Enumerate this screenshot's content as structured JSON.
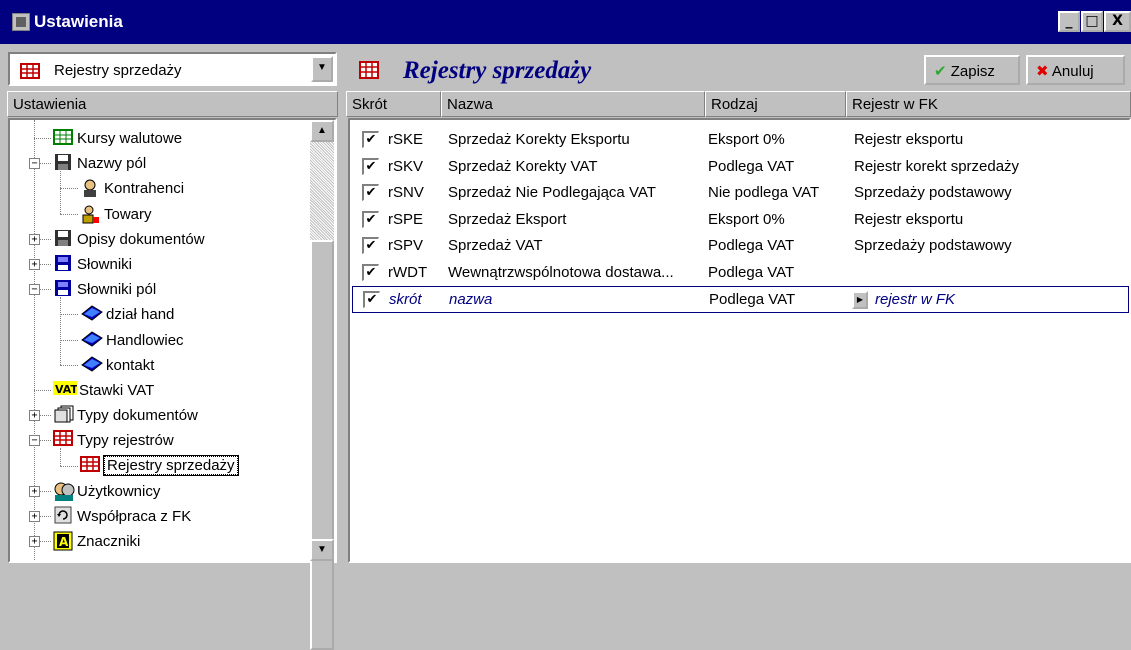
{
  "window": {
    "title": "Ustawienia",
    "min": "_",
    "max": "□",
    "close": "X"
  },
  "left": {
    "combo_value": "Rejestry sprzedaży",
    "header": "Ustawienia",
    "tree": [
      {
        "label": "Kursy walutowe",
        "icon": "table-icon",
        "level": 1
      },
      {
        "label": "Nazwy pól",
        "icon": "disk-icon",
        "level": 0,
        "exp": "−"
      },
      {
        "label": "Kontrahenci",
        "icon": "person-icon",
        "level": 2
      },
      {
        "label": "Towary",
        "icon": "product-icon",
        "level": 2
      },
      {
        "label": "Opisy dokumentów",
        "icon": "disk-icon",
        "level": 0,
        "exp": "+"
      },
      {
        "label": "Słowniki",
        "icon": "book-icon",
        "level": 0,
        "exp": "+"
      },
      {
        "label": "Słowniki pól",
        "icon": "book-icon",
        "level": 0,
        "exp": "−"
      },
      {
        "label": "dział hand",
        "icon": "dictionary-icon",
        "level": 2
      },
      {
        "label": "Handlowiec",
        "icon": "dictionary-icon",
        "level": 2
      },
      {
        "label": "kontakt",
        "icon": "dictionary-icon",
        "level": 2
      },
      {
        "label": "Stawki VAT",
        "icon": "vat-icon",
        "level": 1
      },
      {
        "label": "Typy dokumentów",
        "icon": "documents-icon",
        "level": 0,
        "exp": "+"
      },
      {
        "label": "Typy rejestrów",
        "icon": "register-icon",
        "level": 0,
        "exp": "−"
      },
      {
        "label": "Rejestry sprzedaży",
        "icon": "register-icon",
        "level": 2,
        "selected": true
      },
      {
        "label": "Użytkownicy",
        "icon": "users-icon",
        "level": 0,
        "exp": "+"
      },
      {
        "label": "Współpraca z FK",
        "icon": "sync-icon",
        "level": 0,
        "exp": "+"
      },
      {
        "label": "Znaczniki",
        "icon": "marker-icon",
        "level": 0,
        "exp": "+"
      }
    ],
    "vat_text": "VAT",
    "marker_text": "A"
  },
  "right": {
    "title": "Rejestry sprzedaży",
    "save_label": "Zapisz",
    "cancel_label": "Anuluj",
    "columns": [
      "Skrót",
      "Nazwa",
      "Rodzaj",
      "Rejestr w FK"
    ],
    "rows": [
      {
        "checked": true,
        "skrot": "rSKE",
        "nazwa": "Sprzedaż Korekty Eksportu",
        "rodzaj": "Eksport 0%",
        "rejestr": "Rejestr eksportu"
      },
      {
        "checked": true,
        "skrot": "rSKV",
        "nazwa": "Sprzedaż Korekty VAT",
        "rodzaj": "Podlega VAT",
        "rejestr": "Rejestr korekt sprzedaży"
      },
      {
        "checked": true,
        "skrot": "rSNV",
        "nazwa": "Sprzedaż Nie Podlegająca VAT",
        "rodzaj": "Nie podlega VAT",
        "rejestr": "Sprzedaży podstawowy"
      },
      {
        "checked": true,
        "skrot": "rSPE",
        "nazwa": "Sprzedaż Eksport",
        "rodzaj": "Eksport 0%",
        "rejestr": "Rejestr eksportu"
      },
      {
        "checked": true,
        "skrot": "rSPV",
        "nazwa": "Sprzedaż VAT",
        "rodzaj": "Podlega VAT",
        "rejestr": "Sprzedaży podstawowy"
      },
      {
        "checked": true,
        "skrot": "rWDT",
        "nazwa": "Wewnątrzwspólnotowa dostawa...",
        "rodzaj": "Podlega VAT",
        "rejestr": ""
      }
    ],
    "new_row": {
      "checked": true,
      "skrot": "skrót",
      "nazwa": "nazwa",
      "rodzaj": "Podlega VAT",
      "rejestr": "rejestr w FK"
    }
  },
  "colors": {
    "title_bar": "#000080",
    "accent_text": "#000080",
    "save_check": "#2fa82f",
    "cancel_x": "#e00000"
  }
}
